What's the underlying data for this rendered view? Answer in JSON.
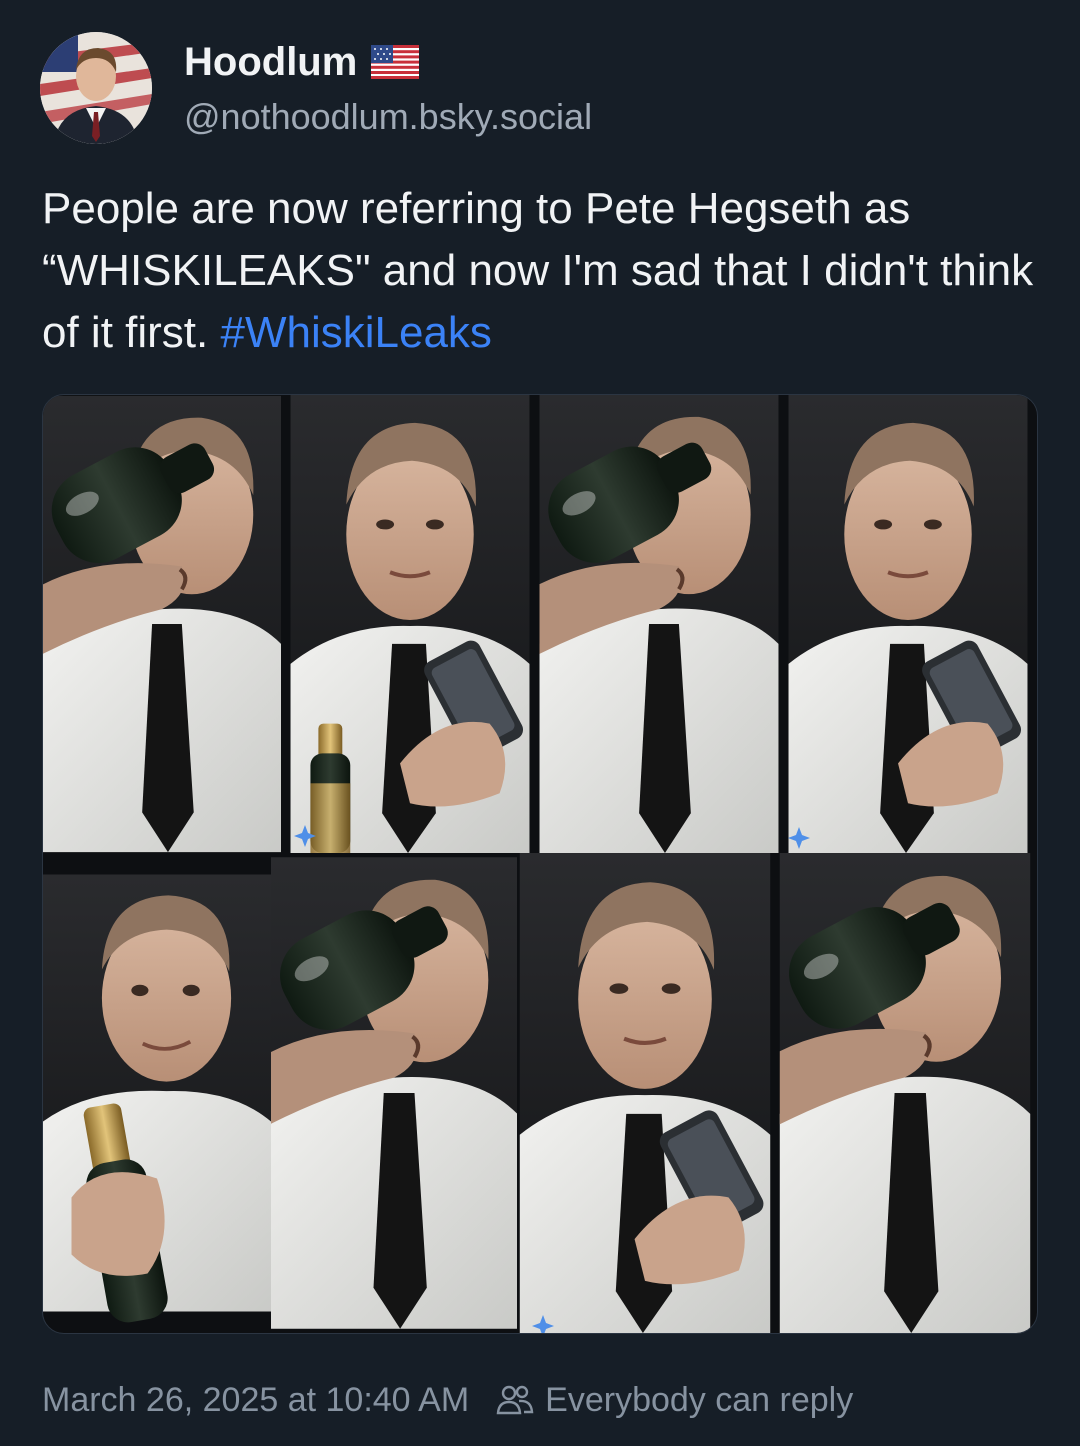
{
  "author": {
    "display_name": "Hoodlum",
    "handle": "@nothoodlum.bsky.social",
    "flag_icon": "us-flag-icon",
    "avatar": "avatar"
  },
  "post": {
    "text": "People are now referring to Pete Hegseth as “WHISKILEAKS\" and now I'm sad that I didn't think of it first. ",
    "hashtag": "#WhiskiLeaks",
    "image": {
      "columns": 4,
      "rows": 2,
      "panels": [
        "man-drinking-from-bottle",
        "man-looking-at-phone-with-champagne-bottle",
        "man-drinking-from-bottle",
        "man-looking-at-phone",
        "man-holding-champagne-bottle-smiling",
        "man-drinking-from-bottle",
        "man-looking-at-phone",
        "man-drinking-from-bottle"
      ]
    }
  },
  "footer": {
    "timestamp": "March 26, 2025 at 10:40 AM",
    "reply_setting": "Everybody can reply",
    "reply_icon": "people-icon"
  },
  "colors": {
    "background": "#161e27",
    "text": "#f1f3f5",
    "muted": "#8793a1",
    "link": "#3b82f6"
  }
}
